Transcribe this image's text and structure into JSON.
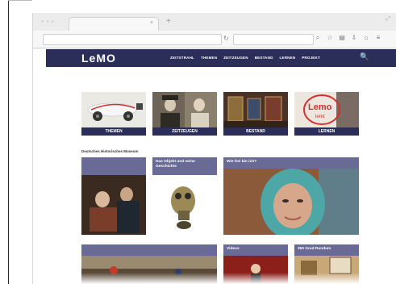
{
  "browser": {
    "tab_title": "",
    "tab_close": "×",
    "new_tab": "+",
    "url": "",
    "search_placeholder": "",
    "reload_icon": "↻",
    "search_icon": "⌕",
    "toolbar_icons": [
      "☆",
      "▤",
      "⇩",
      "⌂",
      "≡"
    ]
  },
  "site": {
    "logo": "LeMO",
    "logo_sub": "",
    "nav": [
      "ZEITSTRAHL",
      "THEMEN",
      "ZEITZEUGEN",
      "BESTAND",
      "LERNEN",
      "PROJEKT"
    ],
    "search_icon": "🔍"
  },
  "tiles": [
    {
      "label": "THEMEN"
    },
    {
      "label": "ZEITZEUGEN"
    },
    {
      "label": "BESTAND"
    },
    {
      "label": "LERNEN"
    }
  ],
  "sections": {
    "left": "Deutsches Historisches Museum",
    "right": ""
  },
  "cards": [
    {
      "title": ""
    },
    {
      "title": "Das Objekt und seine Geschichte"
    },
    {
      "title": "Wie frei bin ich?"
    },
    {
      "title": ""
    },
    {
      "title": "Videos"
    },
    {
      "title": "360 Grad Rundum"
    }
  ],
  "colors": {
    "nav_bg": "#2a2e58",
    "card_header": "#6a6a96",
    "window_bg": "#f1f1f1"
  }
}
